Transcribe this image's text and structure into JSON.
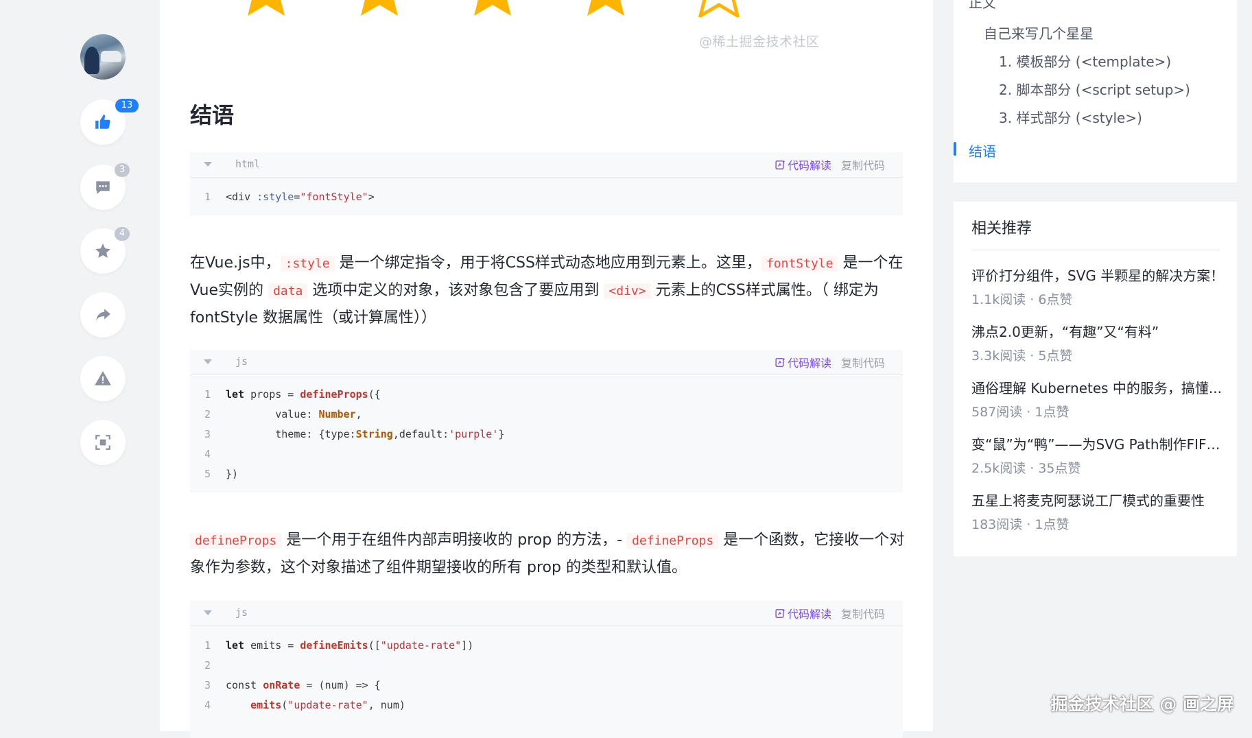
{
  "rail": {
    "like_count": "13",
    "comment_count": "3",
    "collect_count": "4"
  },
  "article": {
    "watermark": "@稀土掘金技术社区",
    "heading": "结语",
    "code_tools": {
      "explain": "代码解读",
      "copy": "复制代码"
    },
    "code1": {
      "lang": "html"
    },
    "para1": {
      "t1": "在Vue.js中，",
      "c1": ":style",
      "t2": " 是一个绑定指令，用于将CSS样式动态地应用到元素上。这里，",
      "c2": "fontStyle",
      "t3": " 是一个在Vue实例的 ",
      "c3": "data",
      "t4": " 选项中定义的对象，该对象包含了要应用到 ",
      "c4": "<div>",
      "t5": " 元素上的CSS样式属性。（ 绑定为 fontStyle 数据属性（或计算属性））"
    },
    "code2": {
      "lang": "js"
    },
    "para2": {
      "c1": "defineProps",
      "t1": " 是一个用于在组件内部声明接收的 prop 的方法，- ",
      "c2": "defineProps",
      "t2": " 是一个函数，它接收一个对象作为参数，这个对象描述了组件期望接收的所有 prop 的类型和默认值。"
    },
    "code3": {
      "lang": "js"
    }
  },
  "toc": {
    "top_partial": "正文",
    "items": [
      "自己来写几个星星",
      "1. 模板部分 (<template>)",
      "2. 脚本部分 (<script setup>)",
      "3. 样式部分 (<style>)",
      "结语"
    ]
  },
  "recommend": {
    "title": "相关推荐",
    "entries": [
      {
        "title": "评价打分组件，SVG 半颗星的解决方案！",
        "meta": "1.1k阅读 · 6点赞"
      },
      {
        "title": "沸点2.0更新，“有趣”又“有料”",
        "meta": "3.3k阅读 · 5点赞"
      },
      {
        "title": "通俗理解 Kubernetes 中的服务，搞懂...",
        "meta": "587阅读 · 1点赞"
      },
      {
        "title": "变“鼠”为“鸭”——为SVG Path制作FIFO...",
        "meta": "2.5k阅读 · 35点赞"
      },
      {
        "title": "五星上将麦克阿瑟说工厂模式的重要性",
        "meta": "183阅读 · 1点赞"
      }
    ]
  },
  "footer_watermark": "掘金技术社区 @ 画之屏",
  "colors": {
    "accent": "#1e80ff",
    "inline_code": "#e4463e",
    "explain": "#7a49f5",
    "star": "#ffb400"
  }
}
